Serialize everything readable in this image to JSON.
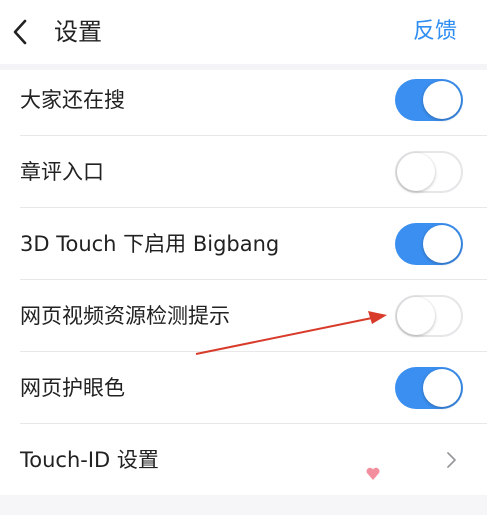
{
  "header": {
    "back_icon": "chevron-left-icon",
    "title": "设置",
    "action_label": "反馈"
  },
  "colors": {
    "accent": "#2f8ef2",
    "toggle_on": "#3b8ff0",
    "toggle_off_border": "#e6e6e8",
    "annotation_arrow": "#d93b2b"
  },
  "settings": {
    "items": [
      {
        "label": "大家还在搜",
        "control": "toggle",
        "state": "on"
      },
      {
        "label": "章评入口",
        "control": "toggle",
        "state": "off"
      },
      {
        "label": "3D Touch 下启用 Bigbang",
        "control": "toggle",
        "state": "on"
      },
      {
        "label": "网页视频资源检测提示",
        "control": "toggle",
        "state": "off"
      },
      {
        "label": "网页护眼色",
        "control": "toggle",
        "state": "on"
      },
      {
        "label": "Touch-ID 设置",
        "control": "chevron",
        "icon": "chevron-right-icon"
      }
    ]
  },
  "annotation": {
    "type": "arrow",
    "points_to": "网页视频资源检测提示 toggle"
  },
  "watermark": {
    "icon": "heart-icon"
  }
}
